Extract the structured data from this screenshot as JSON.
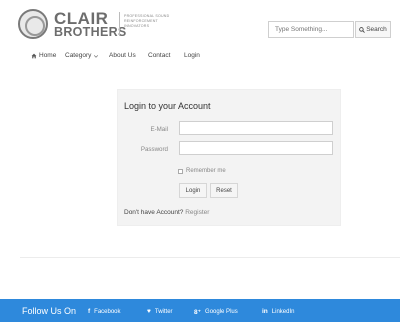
{
  "brand": {
    "name_line1": "CLAIR",
    "name_line2": "BROTHERS",
    "tagline": "PROFESSIONAL SOUND REINFORCEMENT INNOVATORS"
  },
  "search": {
    "placeholder": "Type Something...",
    "button_label": "Search"
  },
  "nav": {
    "items": [
      {
        "label": "Home",
        "icon": "home-icon"
      },
      {
        "label": "Category",
        "icon": "chevron-down-icon"
      },
      {
        "label": "About Us"
      },
      {
        "label": "Contact"
      },
      {
        "label": "Login"
      }
    ]
  },
  "login": {
    "title": "Login to your Account",
    "email_label": "E-Mail",
    "email_value": "",
    "password_label": "Password",
    "password_value": "",
    "remember_label": "Remember me",
    "login_button": "Login",
    "reset_button": "Reset",
    "no_account_text": "Don't have Account?",
    "register_link": "Register"
  },
  "footer": {
    "follow_label": "Follow Us On",
    "links": [
      {
        "label": "Facebook",
        "icon": "facebook-icon",
        "glyph": "f"
      },
      {
        "label": "Twitter",
        "icon": "twitter-icon",
        "glyph": "♥"
      },
      {
        "label": "Google Plus",
        "icon": "google-plus-icon",
        "glyph": "8⁺"
      },
      {
        "label": "LinkedIn",
        "icon": "linkedin-icon",
        "glyph": "in"
      }
    ],
    "color": "#2e89dc"
  }
}
